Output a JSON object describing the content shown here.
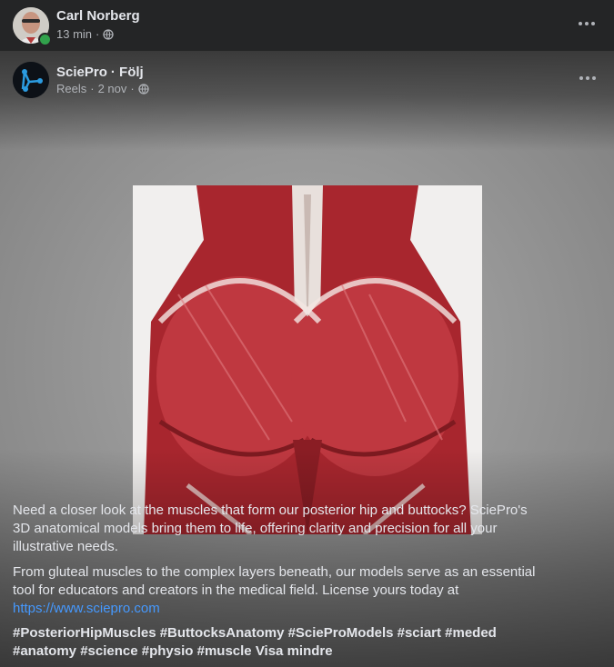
{
  "sharer": {
    "name": "Carl Norberg",
    "time": "13 min",
    "separator": "·"
  },
  "post": {
    "page_name": "SciePro",
    "follow_label": "· Följ",
    "type": "Reels",
    "date": "2 nov",
    "separator": "·"
  },
  "caption": {
    "paragraph1": "Need a closer look at the muscles that form our posterior hip and buttocks? SciePro's 3D anatomical models bring them to life, offering clarity and precision for all your illustrative needs.",
    "paragraph2": " From gluteal muscles to the complex layers beneath, our models serve as an essential tool for educators and creators in the medical field. License yours today at",
    "link": "https://www.sciepro.com",
    "hashtags": "#PosteriorHipMuscles #ButtocksAnatomy #ScieProModels  #sciart #meded #anatomy #science #physio #muscle",
    "see_more": "Visa mindre"
  },
  "colors": {
    "background": "#242526",
    "text": "#e4e6eb",
    "muted": "#b0b3b8",
    "link": "#4599ff",
    "online": "#31a24c",
    "muscle": "#b8303a"
  },
  "icons": {
    "privacy": "globe-icon",
    "more": "more-options-icon"
  }
}
